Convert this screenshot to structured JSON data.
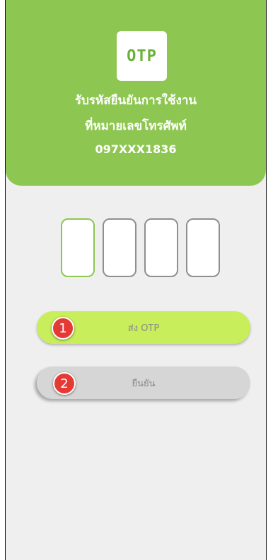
{
  "header": {
    "logo_text": "OTP",
    "line1": "รับรหัสยืนยันการใช้งาน",
    "line2": "ที่หมายเลขโทรศัพท์",
    "phone": "097XXX1836"
  },
  "otp": {
    "digits": [
      "",
      "",
      "",
      ""
    ]
  },
  "buttons": {
    "send_label": "ส่ง OTP",
    "confirm_label": "ยืนยัน"
  },
  "annotations": {
    "badge1": "1",
    "badge2": "2"
  },
  "colors": {
    "header_green": "#8dc650",
    "send_button": "#c9ee5c",
    "confirm_button": "#d6d6d6",
    "badge_red": "#e53935"
  }
}
